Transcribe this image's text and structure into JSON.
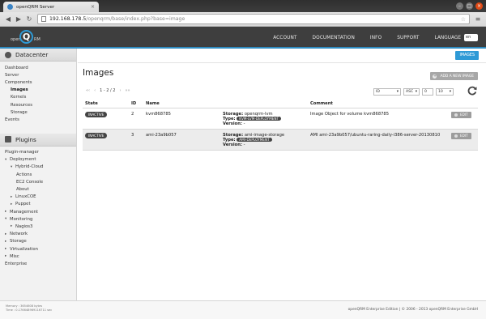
{
  "browser": {
    "tab_title": "openQRM Server",
    "tab_close": "×",
    "url_host": "192.168.178.5",
    "url_path": "/openqrm/base/index.php?base=image",
    "window_controls": [
      "–",
      "□",
      "×"
    ]
  },
  "header": {
    "logo_open": "open",
    "logo_q": "Q",
    "logo_rm": "RM",
    "nav": [
      "ACCOUNT",
      "DOCUMENTATION",
      "INFO",
      "SUPPORT"
    ],
    "language_label": "LANGUAGE",
    "language_value": "en",
    "accent_color": "#2e8bc0"
  },
  "sidebar": {
    "datacenter_title": "Datacenter",
    "datacenter_items": [
      {
        "label": "Dashboard",
        "indent": 0
      },
      {
        "label": "Server",
        "indent": 0
      },
      {
        "label": "Components",
        "indent": 0
      },
      {
        "label": "Images",
        "indent": 1,
        "active": true
      },
      {
        "label": "Kernels",
        "indent": 1
      },
      {
        "label": "Resources",
        "indent": 1
      },
      {
        "label": "Storage",
        "indent": 1
      },
      {
        "label": "Events",
        "indent": 0
      }
    ],
    "plugins_title": "Plugins",
    "plugin_items": [
      {
        "label": "Plugin-manager",
        "indent": 0
      },
      {
        "label": "Deployment",
        "indent": 0,
        "arrow": "▾"
      },
      {
        "label": "Hybrid-Cloud",
        "indent": 1,
        "arrow": "▾"
      },
      {
        "label": "Actions",
        "indent": 2
      },
      {
        "label": "EC2 Console",
        "indent": 2
      },
      {
        "label": "About",
        "indent": 2
      },
      {
        "label": "LinuxCOE",
        "indent": 1,
        "arrow": "▸"
      },
      {
        "label": "Puppet",
        "indent": 1,
        "arrow": "▸"
      },
      {
        "label": "Management",
        "indent": 0,
        "arrow": "▸"
      },
      {
        "label": "Monitoring",
        "indent": 0,
        "arrow": "▾"
      },
      {
        "label": "Nagios3",
        "indent": 1,
        "arrow": "▸"
      },
      {
        "label": "Network",
        "indent": 0,
        "arrow": "▸"
      },
      {
        "label": "Storage",
        "indent": 0,
        "arrow": "▸"
      },
      {
        "label": "Virtualization",
        "indent": 0,
        "arrow": "▸"
      },
      {
        "label": "Misc",
        "indent": 0,
        "arrow": "▸"
      },
      {
        "label": "Enterprise",
        "indent": 0
      }
    ],
    "memory": "Memory : 3654608 bytes",
    "time": "Time : 0.176648969116711 sec"
  },
  "main": {
    "tab_button": "IMAGES",
    "title": "Images",
    "add_button": "ADD A NEW IMAGE",
    "pager": {
      "first": "«‹",
      "prev": "‹",
      "text": "1 - 2 / 2",
      "next": "›",
      "last": "»»"
    },
    "sort_field": "ID",
    "sort_order": "ASC",
    "offset": "0",
    "limit": "10",
    "columns": [
      "State",
      "ID",
      "Name",
      "Comment"
    ],
    "rows": [
      {
        "state": "INACTIVE",
        "id": "2",
        "name": "kvm868785",
        "storage_label": "Storage:",
        "storage": "openqrm-lvm",
        "type_label": "Type:",
        "type": "KVM-LVM-DEPLOYMENT",
        "version_label": "Version:",
        "version": "-",
        "comment": "Image Object for volume kvm868785",
        "edit": "EDIT"
      },
      {
        "state": "INACTIVE",
        "id": "3",
        "name": "ami-23a9b057",
        "storage_label": "Storage:",
        "storage": "ami-image-storage",
        "type_label": "Type:",
        "type": "AMI-DEPLOYMENT",
        "version_label": "Version:",
        "version": "-",
        "comment": "AMI ami-23a9b057/ubuntu-raring-daily-i386-server-20130810",
        "edit": "EDIT"
      }
    ]
  },
  "footer": {
    "copyright": "openQRM Enterprise Edition | © 2006 - 2013 openQRM Enterprise GmbH"
  }
}
